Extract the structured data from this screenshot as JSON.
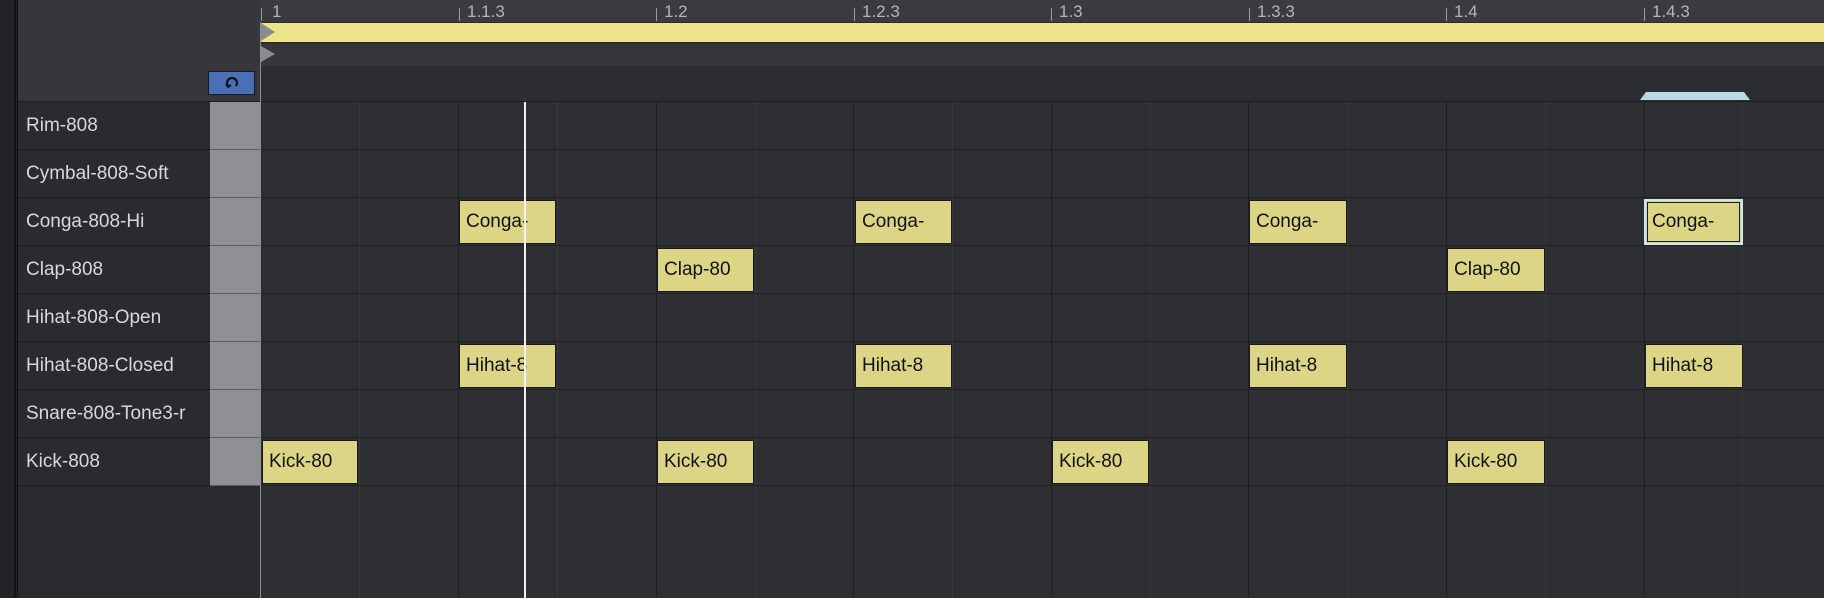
{
  "ruler": {
    "ticks": [
      "1",
      "1.1.3",
      "1.2",
      "1.2.3",
      "1.3",
      "1.3.3",
      "1.4",
      "1.4.3"
    ]
  },
  "loop_button": {
    "icon": "loop-icon"
  },
  "tracks": [
    "Rim-808",
    "Cymbal-808-Soft",
    "Conga-808-Hi",
    "Clap-808",
    "Hihat-808-Open",
    "Hihat-808-Closed",
    "Snare-808-Tone3-r",
    "Kick-808"
  ],
  "notes": {
    "conga": [
      "Conga-",
      "Conga-",
      "Conga-",
      "Conga-"
    ],
    "clap": [
      "Clap-80",
      "Clap-80"
    ],
    "hihat": [
      "Hihat-8",
      "Hihat-8",
      "Hihat-8",
      "Hihat-8"
    ],
    "kick": [
      "Kick-80",
      "Kick-80",
      "Kick-80",
      "Kick-80"
    ]
  },
  "colors": {
    "note_fill": "#dcd585",
    "loop_brace": "#ece48a",
    "selection": "#b8d9e6",
    "loop_button": "#4a6fb5"
  }
}
